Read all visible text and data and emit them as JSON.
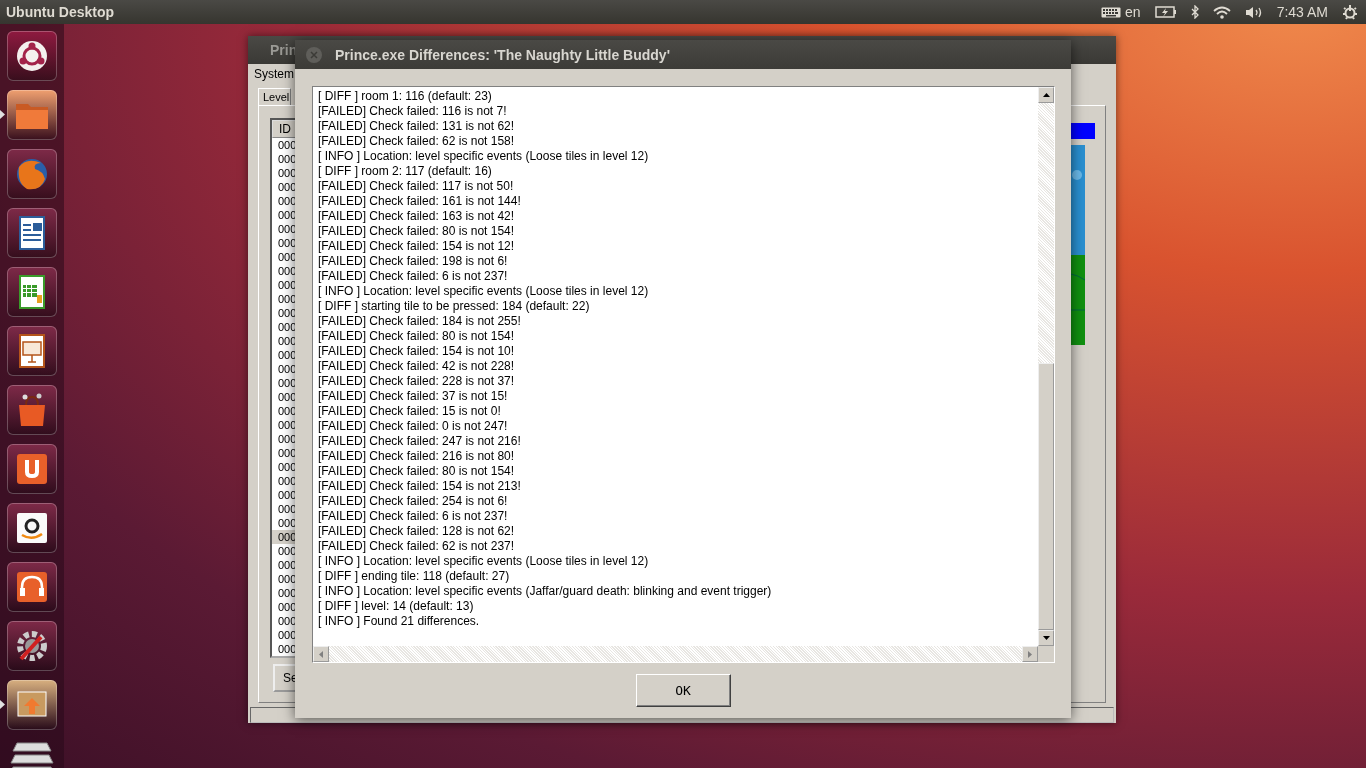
{
  "top_bar": {
    "title": "Ubuntu Desktop",
    "keyboard_layout": "en",
    "clock": "7:43 AM"
  },
  "launcher": [
    {
      "kind": "logo",
      "running": false
    },
    {
      "kind": "folder",
      "running": true
    },
    {
      "kind": "globe",
      "running": false
    },
    {
      "kind": "document",
      "running": false
    },
    {
      "kind": "spreadsheet",
      "running": false
    },
    {
      "kind": "presentation",
      "running": false
    },
    {
      "kind": "bag",
      "running": false
    },
    {
      "kind": "cloud",
      "running": false
    },
    {
      "kind": "smile",
      "running": false
    },
    {
      "kind": "music",
      "running": false
    },
    {
      "kind": "settings",
      "running": false
    },
    {
      "kind": "workspace",
      "running": true
    }
  ],
  "background_window": {
    "title": "Prin",
    "menu": [
      "System"
    ],
    "tab": "Level",
    "list_header": "ID",
    "rows": [
      {
        "id": "000",
        "selected": false
      },
      {
        "id": "000",
        "selected": false
      },
      {
        "id": "000",
        "selected": false
      },
      {
        "id": "000",
        "selected": false
      },
      {
        "id": "000",
        "selected": false
      },
      {
        "id": "000",
        "selected": false
      },
      {
        "id": "000",
        "selected": false
      },
      {
        "id": "000",
        "selected": false
      },
      {
        "id": "000",
        "selected": false
      },
      {
        "id": "000",
        "selected": false
      },
      {
        "id": "000",
        "selected": false
      },
      {
        "id": "000",
        "selected": false
      },
      {
        "id": "000",
        "selected": false
      },
      {
        "id": "000",
        "selected": false
      },
      {
        "id": "000",
        "selected": false
      },
      {
        "id": "000",
        "selected": false
      },
      {
        "id": "000",
        "selected": false
      },
      {
        "id": "000",
        "selected": false
      },
      {
        "id": "000",
        "selected": false
      },
      {
        "id": "000",
        "selected": false
      },
      {
        "id": "000",
        "selected": false
      },
      {
        "id": "000",
        "selected": false
      },
      {
        "id": "000",
        "selected": false
      },
      {
        "id": "000",
        "selected": false
      },
      {
        "id": "000",
        "selected": false
      },
      {
        "id": "000",
        "selected": false
      },
      {
        "id": "000",
        "selected": false
      },
      {
        "id": "000",
        "selected": false
      },
      {
        "id": "000",
        "selected": true
      },
      {
        "id": "000",
        "selected": false
      },
      {
        "id": "000",
        "selected": false
      },
      {
        "id": "000",
        "selected": false
      },
      {
        "id": "000",
        "selected": false
      },
      {
        "id": "000",
        "selected": false
      },
      {
        "id": "000",
        "selected": false
      },
      {
        "id": "000",
        "selected": false
      },
      {
        "id": "000",
        "selected": false
      }
    ],
    "button": "Se"
  },
  "dialog": {
    "title": "Prince.exe Differences: 'The Naughty Little Buddy'",
    "log": [
      "[ DIFF ] room 1: 116 (default: 23)",
      "[FAILED] Check failed: 116 is not 7!",
      "[FAILED] Check failed: 131 is not 62!",
      "[FAILED] Check failed: 62 is not 158!",
      "[ INFO ] Location: level specific events (Loose tiles in level 12)",
      "[ DIFF ] room 2: 117 (default: 16)",
      "[FAILED] Check failed: 117 is not 50!",
      "[FAILED] Check failed: 161 is not 144!",
      "[FAILED] Check failed: 163 is not 42!",
      "[FAILED] Check failed: 80 is not 154!",
      "[FAILED] Check failed: 154 is not 12!",
      "[FAILED] Check failed: 198 is not 6!",
      "[FAILED] Check failed: 6 is not 237!",
      "[ INFO ] Location: level specific events (Loose tiles in level 12)",
      "[ DIFF ] starting tile to be pressed: 184 (default: 22)",
      "[FAILED] Check failed: 184 is not 255!",
      "[FAILED] Check failed: 80 is not 154!",
      "[FAILED] Check failed: 154 is not 10!",
      "[FAILED] Check failed: 42 is not 228!",
      "[FAILED] Check failed: 228 is not 37!",
      "[FAILED] Check failed: 37 is not 15!",
      "[FAILED] Check failed: 15 is not 0!",
      "[FAILED] Check failed: 0 is not 247!",
      "[FAILED] Check failed: 247 is not 216!",
      "[FAILED] Check failed: 216 is not 80!",
      "[FAILED] Check failed: 80 is not 154!",
      "[FAILED] Check failed: 154 is not 213!",
      "[FAILED] Check failed: 254 is not 6!",
      "[FAILED] Check failed: 6 is not 237!",
      "[FAILED] Check failed: 128 is not 62!",
      "[FAILED] Check failed: 62 is not 237!",
      "[ INFO ] Location: level specific events (Loose tiles in level 12)",
      "[ DIFF ] ending tile: 118 (default: 27)",
      "[ INFO ] Location: level specific events (Jaffar/guard death: blinking and event trigger)",
      "[ DIFF ] level: 14 (default: 13)",
      "[ INFO ] Found 21 differences."
    ],
    "button": "OK"
  }
}
